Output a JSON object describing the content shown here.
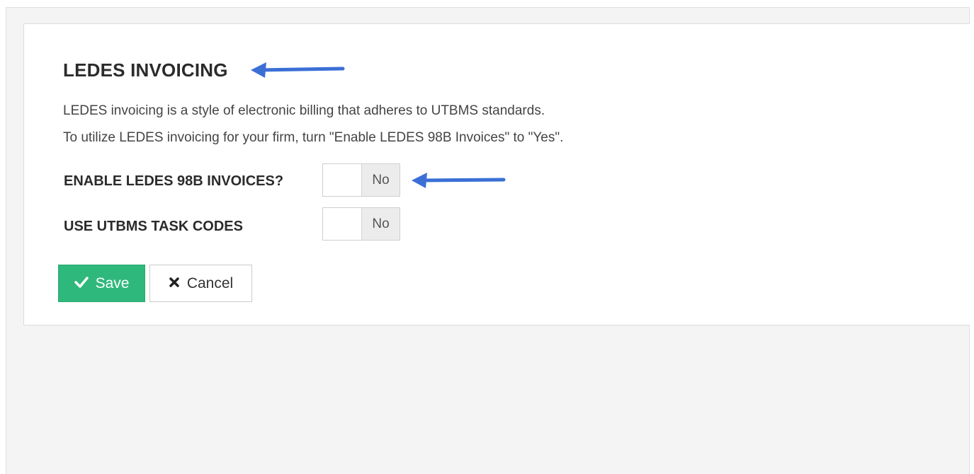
{
  "section": {
    "title": "LEDES INVOICING",
    "description_line1": "LEDES invoicing is a style of electronic billing that adheres to UTBMS standards.",
    "description_line2": "To utilize LEDES invoicing for your firm, turn \"Enable LEDES 98B Invoices\" to \"Yes\"."
  },
  "settings": {
    "enable_ledes": {
      "label": "ENABLE LEDES 98B INVOICES?",
      "value": "No"
    },
    "utbms_task_codes": {
      "label": "USE UTBMS TASK CODES",
      "value": "No"
    }
  },
  "actions": {
    "save_label": "Save",
    "cancel_label": "Cancel",
    "save_icon": "check-icon",
    "cancel_icon": "x-icon"
  },
  "annotations": {
    "arrow_color": "#3b6fd6",
    "arrow_icon": "arrow-left-icon"
  },
  "colors": {
    "save_button": "#2fb87b",
    "toggle_off": "#ececec"
  }
}
